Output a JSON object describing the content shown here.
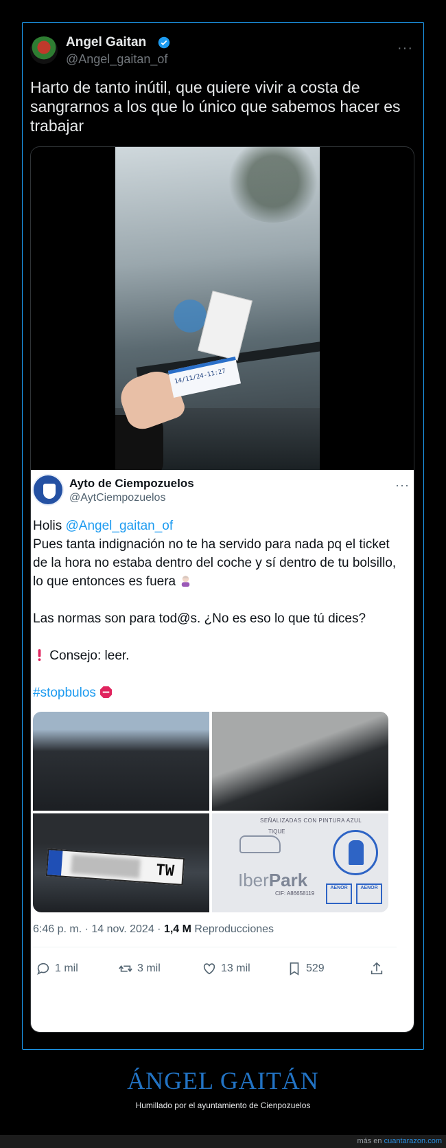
{
  "tweet": {
    "author_name": "Angel Gaitan",
    "author_handle": "@Angel_gaitan_of",
    "text": "Harto de tanto inútil, que quiere vivir a costa de sangrarnos a los que lo único que sabemos hacer es trabajar",
    "more_label": "···"
  },
  "video": {
    "ticket_text": "14/11/24-11:27"
  },
  "quote": {
    "author_name": "Ayto de Ciempozuelos",
    "author_handle": "@AytCiempozuelos",
    "more_label": "···",
    "greeting": "Holis ",
    "mention": "@Angel_gaitan_of",
    "body_1": "Pues tanta indignación no te ha servido para nada pq el ticket de la hora no estaba dentro del coche y sí dentro de tu bolsillo, lo que entonces es fuera",
    "body_2": "Las normas son para tod@s. ¿No es eso lo que tú dices?",
    "body_3": "Consejo: leer.",
    "hashtag": "#stopbulos",
    "images": {
      "plate_text": "TW",
      "sign_top": "SEÑALIZADAS CON PINTURA AZUL",
      "sign_tique": "TIQUE",
      "sign_brand_a": "Iber",
      "sign_brand_b": "Park",
      "sign_cif": "CIF: A86658119",
      "aenor_1": "AENOR",
      "aenor_2": "AENOR"
    },
    "time": "6:46 p. m.",
    "date": "14 nov. 2024",
    "views_count": "1,4 M",
    "views_label": "Reproducciones",
    "separator": " · ",
    "actions": {
      "replies": "1 mil",
      "reposts": "3 mil",
      "likes": "13 mil",
      "bookmarks": "529"
    }
  },
  "footer": {
    "title": "ÁNGEL GAITÁN",
    "subtitle": "Humillado por el ayuntamiento de Cienpozuelos",
    "credit_prefix": "más en ",
    "credit_link": "cuantarazon.com"
  },
  "colors": {
    "accent": "#1d9bf0",
    "footer_title": "#2273c4"
  }
}
